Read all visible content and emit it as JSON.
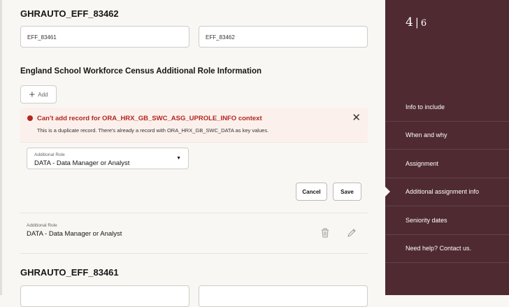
{
  "section1": {
    "title": "GHRAUTO_EFF_83462",
    "field1": "EFF_83461",
    "field2": "EFF_83462"
  },
  "census": {
    "title": "England School Workforce Census Additional Role Information",
    "add_label": "Add"
  },
  "error": {
    "title": "Can't add record for ORA_HRX_GB_SWC_ASG_UPROLE_INFO context",
    "detail": "This is a duplicate record. There's already a record with ORA_HRX_GB_SWC_DATA as key values.",
    "close": "✕"
  },
  "form": {
    "label": "Additional Role",
    "value": "DATA - Data Manager or Analyst",
    "cancel": "Cancel",
    "save": "Save"
  },
  "record": {
    "label": "Additional Role",
    "value": "DATA - Data Manager or Analyst"
  },
  "section2": {
    "title": "GHRAUTO_EFF_83461"
  },
  "sidebar": {
    "step_current": "4",
    "step_total": "6",
    "items": [
      "Info to include",
      "When and why",
      "Assignment",
      "Additional assignment info",
      "Seniority dates",
      "Need help? Contact us."
    ],
    "active_index": 3
  },
  "colors": {
    "sidebar": "#4f2a31",
    "error": "#b3261e"
  }
}
